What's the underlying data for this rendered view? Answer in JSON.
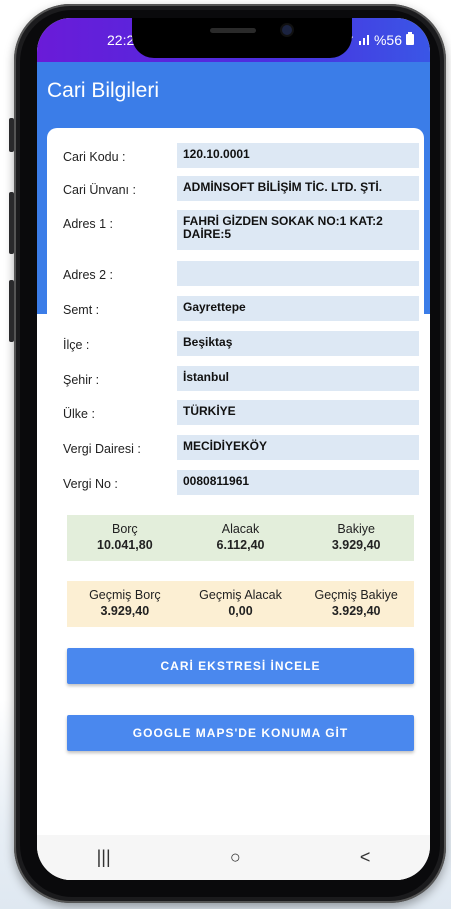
{
  "status": {
    "time": "22:2",
    "battery": "%56"
  },
  "appbar": {
    "title": "Cari Bilgileri"
  },
  "fields": [
    {
      "label": "Cari Kodu :",
      "value": "120.10.0001"
    },
    {
      "label": "Cari Ünvanı :",
      "value": "ADMİNSOFT BİLİŞİM TİC. LTD. ŞTİ."
    },
    {
      "label": "Adres 1 :",
      "value": "FAHRİ GİZDEN SOKAK NO:1 KAT:2 DAİRE:5"
    },
    {
      "label": "Adres 2 :",
      "value": ""
    },
    {
      "label": "Semt :",
      "value": "Gayrettepe"
    },
    {
      "label": "İlçe :",
      "value": "Beşiktaş"
    },
    {
      "label": "Şehir :",
      "value": "İstanbul"
    },
    {
      "label": "Ülke :",
      "value": "TÜRKİYE"
    },
    {
      "label": "Vergi Dairesi :",
      "value": "MECİDİYEKÖY"
    },
    {
      "label": "Vergi No :",
      "value": "0080811961"
    }
  ],
  "balance": {
    "borc_label": "Borç",
    "borc": "10.041,80",
    "alacak_label": "Alacak",
    "alacak": "6.112,40",
    "bakiye_label": "Bakiye",
    "bakiye": "3.929,40",
    "color": "#e3eedb"
  },
  "past": {
    "borc_label": "Geçmiş Borç",
    "borc": "3.929,40",
    "alacak_label": "Geçmiş Alacak",
    "alacak": "0,00",
    "bakiye_label": "Geçmiş Bakiye",
    "bakiye": "3.929,40",
    "color": "#fcefd3"
  },
  "buttons": {
    "statement": "CARİ EKSTRESİ İNCELE",
    "maps": "GOOGLE MAPS'DE KONUMA GİT"
  },
  "nav": {
    "recents": "|||",
    "home": "○",
    "back": "<"
  },
  "colors": {
    "accent": "#3b7de8",
    "button": "#4a88ee",
    "field_bg": "#dde8f4"
  }
}
